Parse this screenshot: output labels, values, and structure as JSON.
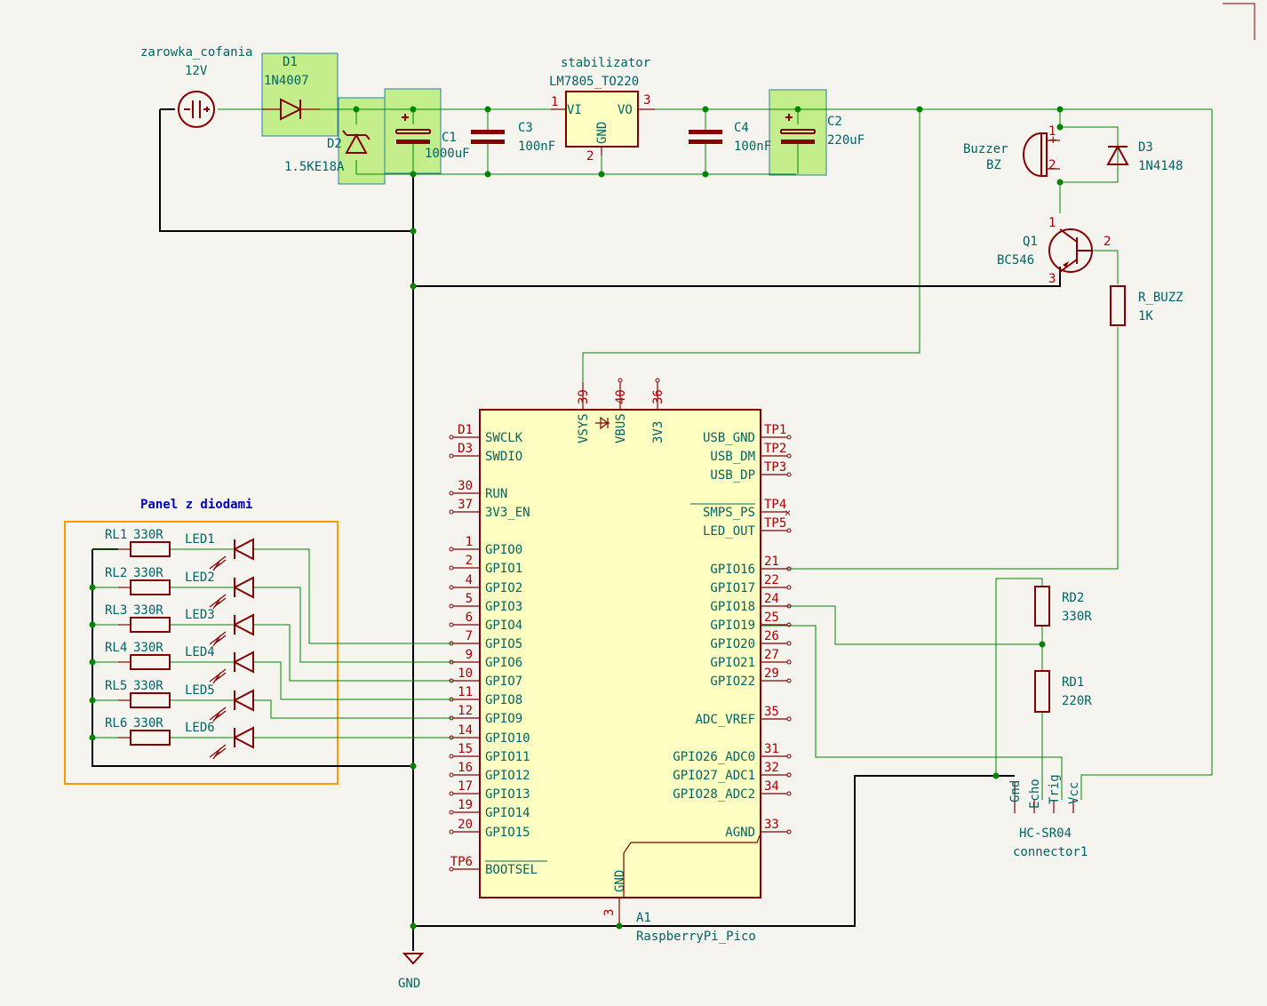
{
  "components": {
    "lamp": {
      "ref": "zarowka_cofania",
      "value": "12V"
    },
    "d1": {
      "ref": "D1",
      "value": "1N4007"
    },
    "d2": {
      "ref": "D2",
      "value": "1.5KE18A"
    },
    "c1": {
      "ref": "C1",
      "value": "1000uF"
    },
    "c3": {
      "ref": "C3",
      "value": "100nF"
    },
    "reg": {
      "ref": "stabilizator",
      "value": "LM7805_TO220",
      "vi": "VI",
      "vo": "VO",
      "gnd": "GND",
      "p1": "1",
      "p2": "2",
      "p3": "3"
    },
    "c4": {
      "ref": "C4",
      "value": "100nF"
    },
    "c2": {
      "ref": "C2",
      "value": "220uF"
    },
    "buzzer": {
      "ref": "Buzzer",
      "value": "BZ",
      "p1": "1",
      "p2": "2",
      "plus": "+"
    },
    "d3": {
      "ref": "D3",
      "value": "1N4148"
    },
    "q1": {
      "ref": "Q1",
      "value": "BC546",
      "p1": "1",
      "p2": "2",
      "p3": "3"
    },
    "rbuzz": {
      "ref": "R_BUZZ",
      "value": "1K"
    },
    "rd2": {
      "ref": "RD2",
      "value": "330R"
    },
    "rd1": {
      "ref": "RD1",
      "value": "220R"
    },
    "hcsr04": {
      "ref": "HC-SR04",
      "value": "connector1",
      "pins": [
        "Gnd",
        "Echo",
        "Trig",
        "Vcc"
      ]
    },
    "pico": {
      "ref": "A1",
      "value": "RaspberryPi_Pico"
    },
    "gnd": {
      "label": "GND"
    }
  },
  "panel": {
    "title": "Panel z diodami",
    "rows": [
      {
        "r": "RL1",
        "rv": "330R",
        "led": "LED1"
      },
      {
        "r": "RL2",
        "rv": "330R",
        "led": "LED2"
      },
      {
        "r": "RL3",
        "rv": "330R",
        "led": "LED3"
      },
      {
        "r": "RL4",
        "rv": "330R",
        "led": "LED4"
      },
      {
        "r": "RL5",
        "rv": "330R",
        "led": "LED5"
      },
      {
        "r": "RL6",
        "rv": "330R",
        "led": "LED6"
      }
    ]
  },
  "pico_pins": {
    "top": [
      {
        "num": "39",
        "name": "VSYS"
      },
      {
        "num": "40",
        "name": "VBUS"
      },
      {
        "num": "36",
        "name": "3V3"
      }
    ],
    "left": [
      {
        "num": "D1",
        "name": "SWCLK"
      },
      {
        "num": "D3",
        "name": "SWDIO"
      },
      {
        "num": "30",
        "name": "RUN"
      },
      {
        "num": "37",
        "name": "3V3_EN"
      },
      {
        "num": "1",
        "name": "GPIO0"
      },
      {
        "num": "2",
        "name": "GPIO1"
      },
      {
        "num": "4",
        "name": "GPIO2"
      },
      {
        "num": "5",
        "name": "GPIO3"
      },
      {
        "num": "6",
        "name": "GPIO4"
      },
      {
        "num": "7",
        "name": "GPIO5"
      },
      {
        "num": "9",
        "name": "GPIO6"
      },
      {
        "num": "10",
        "name": "GPIO7"
      },
      {
        "num": "11",
        "name": "GPIO8"
      },
      {
        "num": "12",
        "name": "GPIO9"
      },
      {
        "num": "14",
        "name": "GPIO10"
      },
      {
        "num": "15",
        "name": "GPIO11"
      },
      {
        "num": "16",
        "name": "GPIO12"
      },
      {
        "num": "17",
        "name": "GPIO13"
      },
      {
        "num": "19",
        "name": "GPIO14"
      },
      {
        "num": "20",
        "name": "GPIO15"
      },
      {
        "num": "TP6",
        "name": "BOOTSEL"
      }
    ],
    "right": [
      {
        "num": "TP1",
        "name": "USB_GND"
      },
      {
        "num": "TP2",
        "name": "USB_DM"
      },
      {
        "num": "TP3",
        "name": "USB_DP"
      },
      {
        "num": "TP4",
        "name": "SMPS_PS"
      },
      {
        "num": "TP5",
        "name": "LED_OUT"
      },
      {
        "num": "21",
        "name": "GPIO16"
      },
      {
        "num": "22",
        "name": "GPIO17"
      },
      {
        "num": "24",
        "name": "GPIO18"
      },
      {
        "num": "25",
        "name": "GPIO19"
      },
      {
        "num": "26",
        "name": "GPIO20"
      },
      {
        "num": "27",
        "name": "GPIO21"
      },
      {
        "num": "29",
        "name": "GPIO22"
      },
      {
        "num": "35",
        "name": "ADC_VREF"
      },
      {
        "num": "31",
        "name": "GPIO26_ADC0"
      },
      {
        "num": "32",
        "name": "GPIO27_ADC1"
      },
      {
        "num": "34",
        "name": "GPIO28_ADC2"
      },
      {
        "num": "33",
        "name": "AGND"
      }
    ],
    "bottom": [
      {
        "num": "3",
        "name": "GND"
      }
    ]
  }
}
